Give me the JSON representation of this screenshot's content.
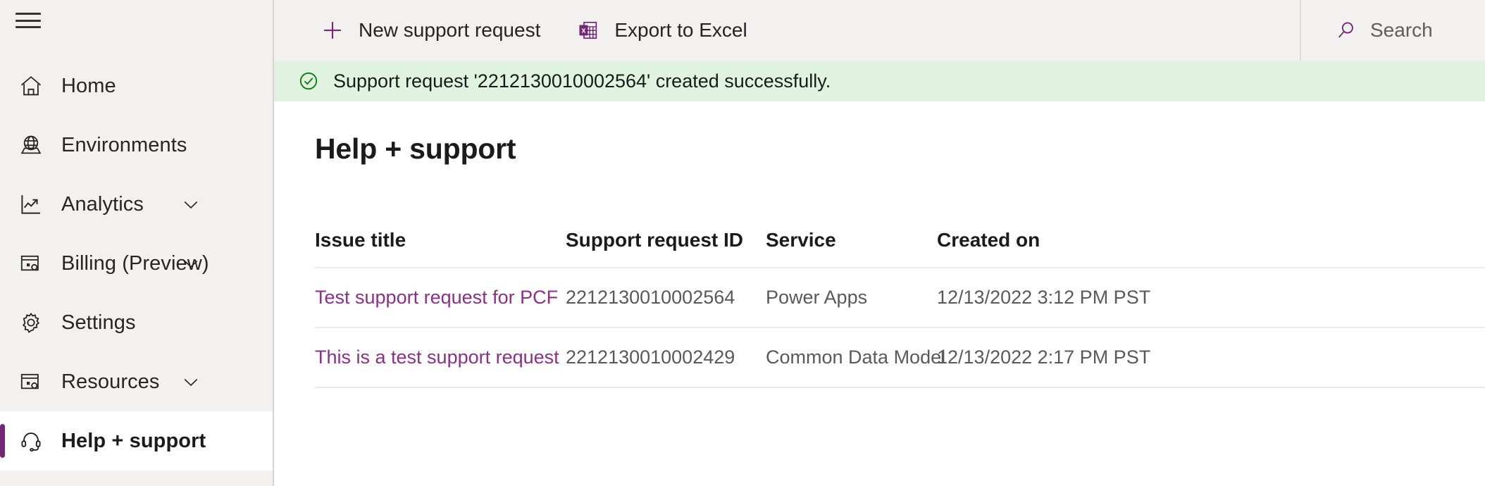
{
  "sidebar": {
    "menu_icon": "hamburger-icon",
    "items": [
      {
        "label": "Home",
        "icon": "home-icon",
        "expandable": false,
        "selected": false
      },
      {
        "label": "Environments",
        "icon": "globe-icon",
        "expandable": false,
        "selected": false
      },
      {
        "label": "Analytics",
        "icon": "chart-line-icon",
        "expandable": true,
        "selected": false
      },
      {
        "label": "Billing (Preview)",
        "icon": "billing-window-gear-icon",
        "expandable": true,
        "selected": false
      },
      {
        "label": "Settings",
        "icon": "gear-icon",
        "expandable": false,
        "selected": false
      },
      {
        "label": "Resources",
        "icon": "resources-window-gear-icon",
        "expandable": true,
        "selected": false
      },
      {
        "label": "Help + support",
        "icon": "headset-icon",
        "expandable": false,
        "selected": true
      }
    ]
  },
  "commandbar": {
    "new_request_label": "New support request",
    "new_request_icon": "plus-icon",
    "export_label": "Export to Excel",
    "export_icon": "excel-icon"
  },
  "search": {
    "placeholder": "Search",
    "value": "",
    "icon": "search-icon"
  },
  "banner": {
    "icon": "success-check-circle-icon",
    "message": "Support request '2212130010002564' created successfully."
  },
  "page": {
    "title": "Help + support"
  },
  "table": {
    "columns": [
      "Issue title",
      "Support request ID",
      "Service",
      "Created on"
    ],
    "rows": [
      {
        "issue_title": "Test support request for PCF",
        "request_id": "2212130010002564",
        "service": "Power Apps",
        "created_on": "12/13/2022 3:12 PM PST"
      },
      {
        "issue_title": "This is a test support request",
        "request_id": "2212130010002429",
        "service": "Common Data Model",
        "created_on": "12/13/2022 2:17 PM PST"
      }
    ]
  },
  "colors": {
    "accent_purple": "#742774",
    "link_purple": "#8b2f8b",
    "banner_green_bg": "#dff3e0",
    "banner_green_icon": "#107c10",
    "sidebar_bg": "#f2f1f0",
    "commandbar_bg": "#f2f1f0"
  }
}
